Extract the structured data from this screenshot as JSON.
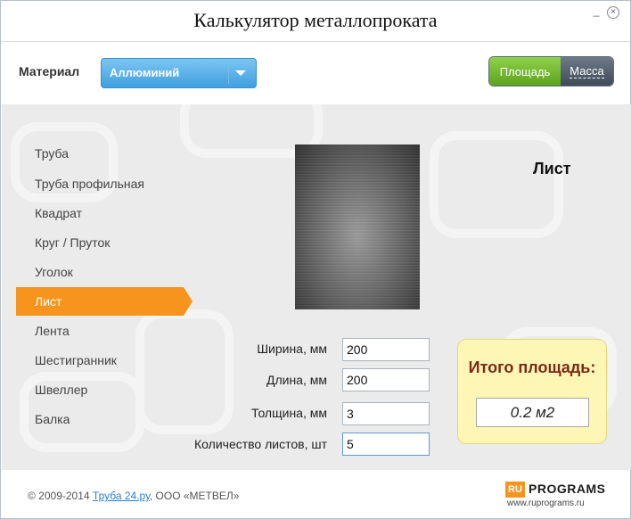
{
  "window": {
    "title": "Калькулятор металлопроката",
    "min_symbol": "_",
    "close_symbol": "×"
  },
  "material": {
    "label": "Материал",
    "selected": "Аллюминий"
  },
  "mode_toggle": {
    "area_label": "Площадь",
    "mass_label": "Масса",
    "active": "area"
  },
  "menu": [
    {
      "label": "Труба",
      "active": false
    },
    {
      "label": "Труба профильная",
      "active": false
    },
    {
      "label": "Квадрат",
      "active": false
    },
    {
      "label": "Круг / Пруток",
      "active": false
    },
    {
      "label": "Уголок",
      "active": false
    },
    {
      "label": "Лист",
      "active": true
    },
    {
      "label": "Лента",
      "active": false
    },
    {
      "label": "Шестигранник",
      "active": false
    },
    {
      "label": "Швеллер",
      "active": false
    },
    {
      "label": "Балка",
      "active": false
    }
  ],
  "product": {
    "title": "Лист"
  },
  "fields": [
    {
      "label": "Ширина, мм",
      "value": "200"
    },
    {
      "label": "Длина, мм",
      "value": "200"
    },
    {
      "label": "Толщина, мм",
      "value": "3"
    },
    {
      "label": "Количество листов, шт",
      "value": "5"
    }
  ],
  "result": {
    "title": "Итого площадь:",
    "value": "0.2 м2"
  },
  "footer": {
    "copyright": "© 2009-2014 ",
    "link": "Труба 24.ру",
    "company": ", ООО «МЕТВЕЛ»"
  },
  "watermark": {
    "ru": "RU",
    "programs": "PROGRAMS",
    "site": "www.ruprograms.ru"
  },
  "colors": {
    "accent_orange": "#f7941d",
    "select_blue": "#3f9fe0",
    "toggle_green": "#5da31e",
    "result_bg": "#fdf6b4"
  }
}
